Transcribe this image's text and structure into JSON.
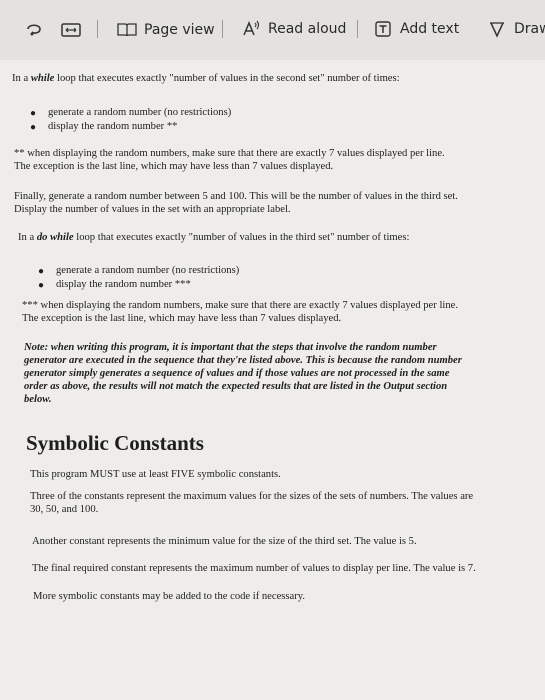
{
  "toolbar": {
    "page_view": "Page view",
    "read_aloud": "Read aloud",
    "add_text": "Add text",
    "draw": "Draw"
  },
  "doc": {
    "p1": {
      "pre": "In a ",
      "kw": "while",
      "post": " loop that executes exactly \"number of values in the second set\" number of times:"
    },
    "list1": [
      "generate a random number (no restrictions)",
      "display the random number **"
    ],
    "note2_line1": "** when displaying the random numbers, make sure that there are exactly 7 values displayed per line.",
    "note2_line2": "The exception is the last line, which may have less than 7 values displayed.",
    "p3_line1": "Finally, generate a random number between 5 and 100. This will be the number of values in the third set.",
    "p3_line2": "Display the number of values in the set with an appropriate label.",
    "p4": {
      "pre": "In a ",
      "kw": "do while",
      "post": " loop that executes exactly \"number of values in the third set\" number of times:"
    },
    "list2": [
      "generate a random number (no restrictions)",
      "display the random number ***"
    ],
    "note3_line1": "*** when displaying the random numbers, make sure that there are exactly 7 values displayed per line.",
    "note3_line2": "The exception is the last line, which may have less than 7 values displayed.",
    "note_lines": [
      "Note: when writing this program, it is important that the steps that involve the random number",
      "generator are executed in the sequence that they're listed above. This is because the random number",
      "generator simply generates a sequence of values and if those values are not processed in the same",
      "order as above, the results will not match the expected results that are listed in the Output section",
      "below."
    ],
    "heading": "Symbolic Constants",
    "sc1": "This program MUST use at least FIVE symbolic constants.",
    "sc2_line1": "Three of the constants represent the maximum values for the sizes of the sets of numbers. The values are",
    "sc2_line2": "30, 50, and 100.",
    "sc3": "Another constant represents the minimum value for the size of the third set. The value is 5.",
    "sc4": "The final required constant represents the maximum number of values to display per line. The value is 7.",
    "sc5": "More symbolic constants may be added to the code if necessary."
  }
}
